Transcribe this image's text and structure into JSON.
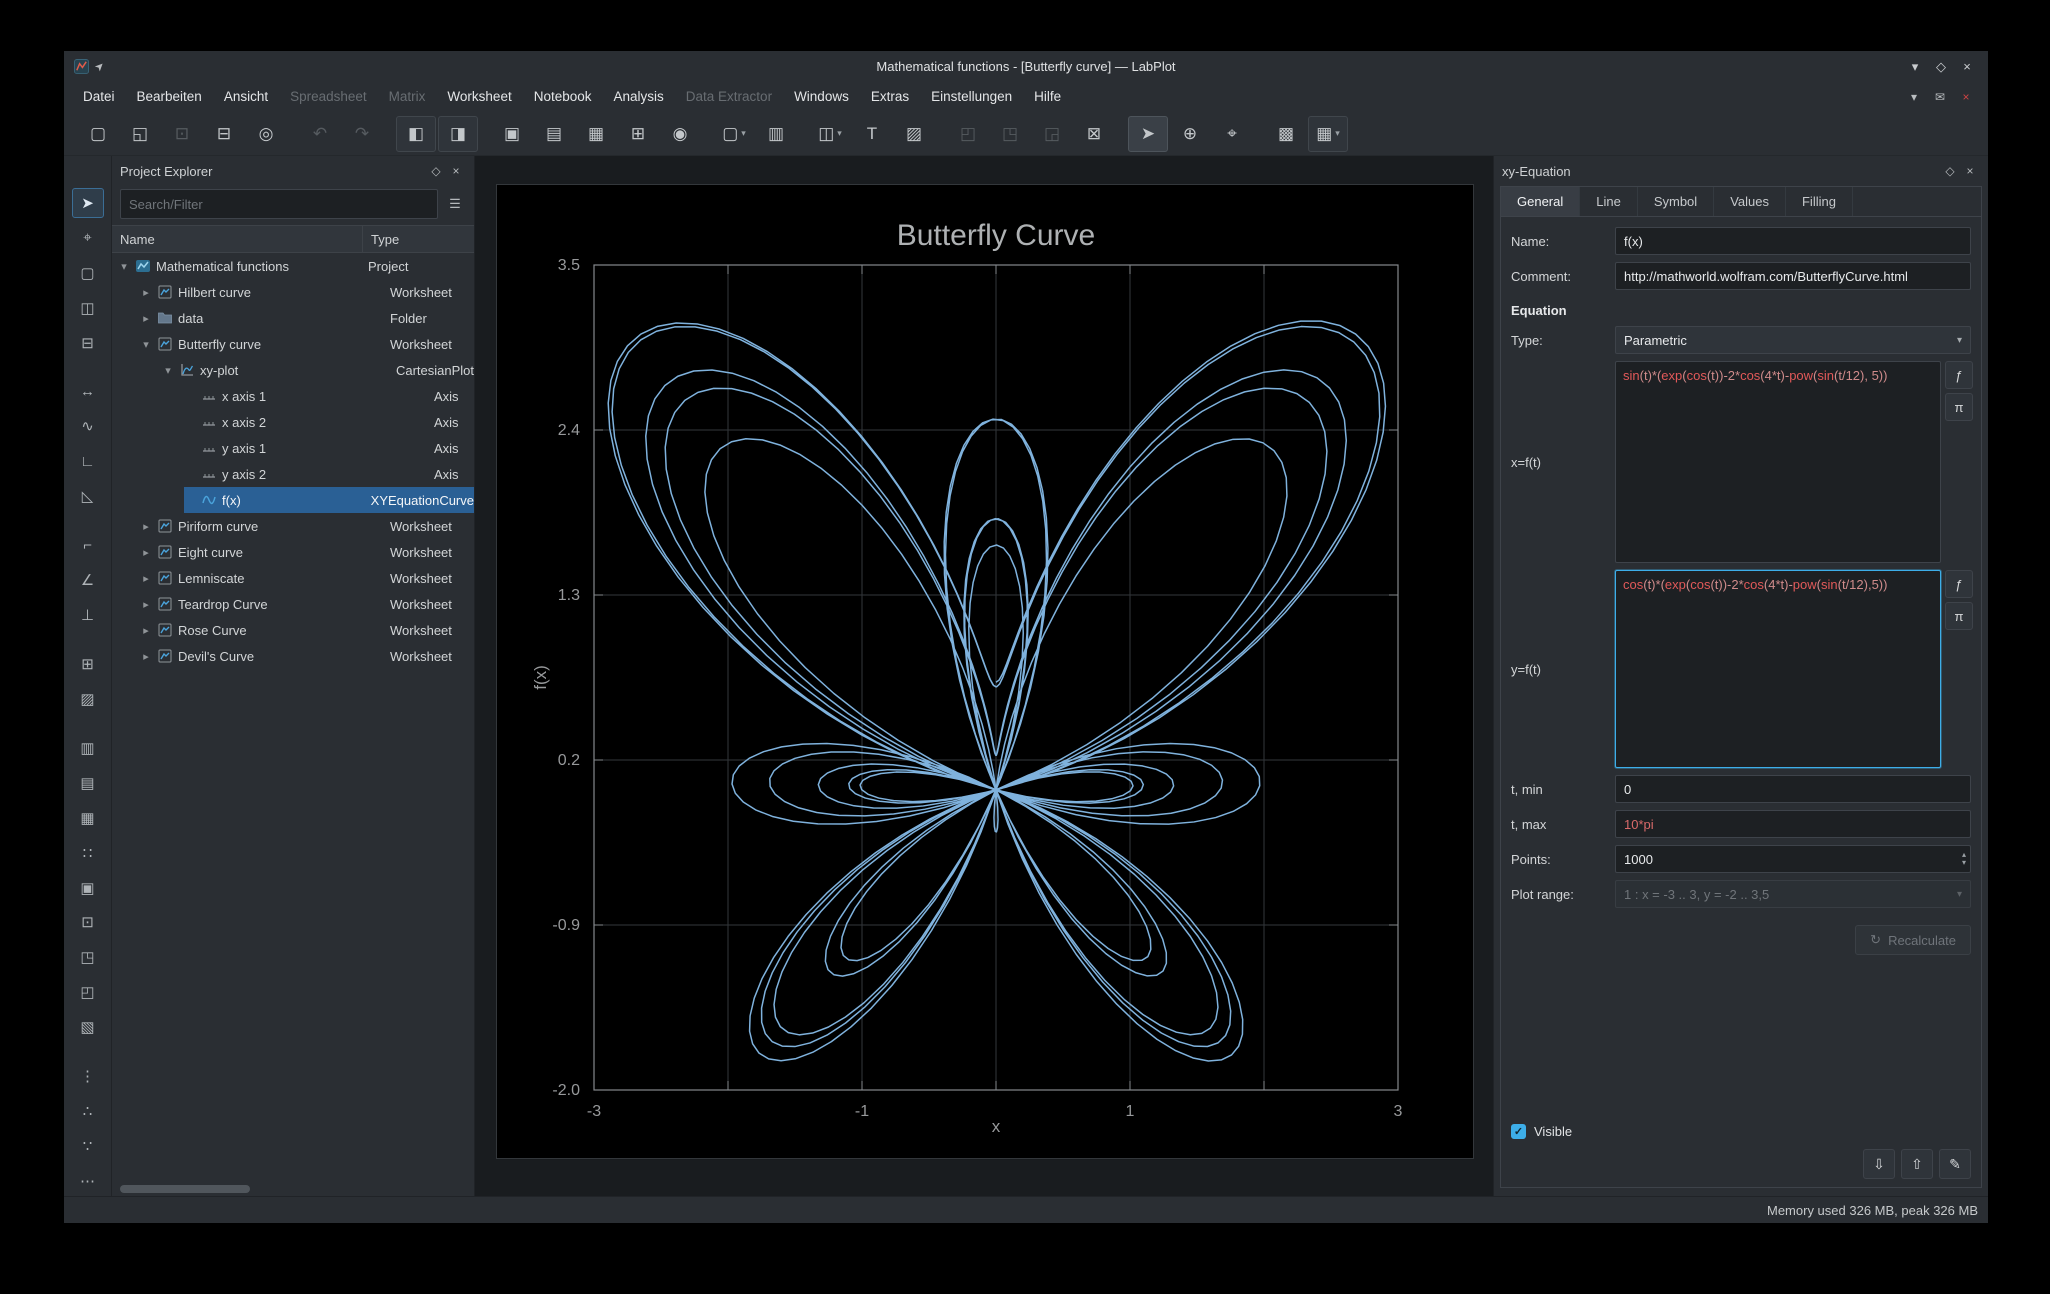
{
  "window": {
    "title": "Mathematical functions - [Butterfly curve] — LabPlot"
  },
  "icons": {
    "minimize": "▾",
    "maximize": "◇",
    "close": "×",
    "float": "◇",
    "chevron_down": "▾",
    "spin_up": "▴",
    "spin_down": "▾",
    "check": "✓",
    "filter": "☰",
    "recalculate": "↻",
    "pin": "➤"
  },
  "menubar": {
    "items": [
      {
        "label": "Datei",
        "enabled": true
      },
      {
        "label": "Bearbeiten",
        "enabled": true
      },
      {
        "label": "Ansicht",
        "enabled": true
      },
      {
        "label": "Spreadsheet",
        "enabled": false
      },
      {
        "label": "Matrix",
        "enabled": false
      },
      {
        "label": "Worksheet",
        "enabled": true
      },
      {
        "label": "Notebook",
        "enabled": true
      },
      {
        "label": "Analysis",
        "enabled": true
      },
      {
        "label": "Data Extractor",
        "enabled": false
      },
      {
        "label": "Windows",
        "enabled": true
      },
      {
        "label": "Extras",
        "enabled": true
      },
      {
        "label": "Einstellungen",
        "enabled": true
      },
      {
        "label": "Hilfe",
        "enabled": true
      }
    ],
    "right_icons": [
      {
        "name": "toolbar-overflow-icon",
        "glyph": "▾",
        "color": "#b9bdc0"
      },
      {
        "name": "donate-icon",
        "glyph": "✉",
        "color": "#b9bdc0"
      },
      {
        "name": "close-document-icon",
        "glyph": "×",
        "color": "#cc4444"
      }
    ]
  },
  "toolbar": {
    "buttons": [
      {
        "name": "new-project",
        "glyph": "▢"
      },
      {
        "name": "open-project",
        "glyph": "◱"
      },
      {
        "name": "save-project",
        "glyph": "⊡",
        "state": "disabled"
      },
      {
        "name": "print",
        "glyph": "⊟"
      },
      {
        "name": "print-preview",
        "glyph": "◎"
      },
      {
        "name": "undo",
        "glyph": "↶",
        "state": "disabled",
        "gap_before": true
      },
      {
        "name": "redo",
        "glyph": "↷",
        "state": "disabled"
      },
      {
        "name": "workbook-view",
        "glyph": "◧",
        "state": "bordered",
        "gap_before": true
      },
      {
        "name": "split-view",
        "glyph": "◨",
        "state": "bordered"
      },
      {
        "name": "new-folder",
        "glyph": "▣",
        "gap_before": true
      },
      {
        "name": "new-spreadsheet",
        "glyph": "▤"
      },
      {
        "name": "new-matrix",
        "glyph": "▦"
      },
      {
        "name": "import-data",
        "glyph": "⊞"
      },
      {
        "name": "color-theme",
        "glyph": "◉"
      },
      {
        "name": "new-worksheet",
        "glyph": "▢",
        "chevron": true,
        "gap_before": true
      },
      {
        "name": "new-notebook",
        "glyph": "▥"
      },
      {
        "name": "zoom-mode",
        "glyph": "◫",
        "chevron": true,
        "gap_before": true
      },
      {
        "name": "add-text-label",
        "glyph": "T"
      },
      {
        "name": "add-image",
        "glyph": "▨"
      },
      {
        "name": "group-objects",
        "glyph": "◰",
        "state": "disabled",
        "gap_before": true
      },
      {
        "name": "align-objects",
        "glyph": "◳",
        "state": "disabled"
      },
      {
        "name": "arrange-objects",
        "glyph": "◲",
        "state": "disabled"
      },
      {
        "name": "break-layout",
        "glyph": "⊠"
      },
      {
        "name": "pointer-mode",
        "glyph": "➤",
        "state": "active",
        "gap_before": true
      },
      {
        "name": "crosshair-mode",
        "glyph": "⊕"
      },
      {
        "name": "zoom-fit",
        "glyph": "⌖"
      },
      {
        "name": "presenter-mode",
        "glyph": "▩",
        "gap_before": true
      },
      {
        "name": "cartesian-plot-add",
        "glyph": "▦",
        "state": "bordered",
        "chevron": true
      }
    ]
  },
  "left_toolbar": {
    "buttons": [
      {
        "name": "select-tool",
        "glyph": "➤",
        "state": "active"
      },
      {
        "name": "crosshair-tool",
        "glyph": "⌖"
      },
      {
        "name": "zoom-select-tool",
        "glyph": "▢"
      },
      {
        "name": "zoom-x-tool",
        "glyph": "◫"
      },
      {
        "name": "zoom-y-tool",
        "glyph": "⊟"
      },
      {
        "name": "shift-curve-tool",
        "glyph": "↔",
        "gap_before": true
      },
      {
        "name": "add-curve-tool",
        "glyph": "∿"
      },
      {
        "name": "add-axis-tool",
        "glyph": "∟"
      },
      {
        "name": "add-legend-tool",
        "glyph": "◺"
      },
      {
        "name": "corner-axis-tool",
        "glyph": "⌐",
        "gap_before": true
      },
      {
        "name": "angle-tool",
        "glyph": "∠"
      },
      {
        "name": "perpendicular-tool",
        "glyph": "⊥"
      },
      {
        "name": "add-grid-tool",
        "glyph": "⊞",
        "gap_before": true
      },
      {
        "name": "add-image-tool",
        "glyph": "▨"
      },
      {
        "name": "layout-v-tool",
        "glyph": "▥",
        "gap_before": true
      },
      {
        "name": "layout-h-tool",
        "glyph": "▤"
      },
      {
        "name": "layout-grid-tool",
        "glyph": "▦"
      },
      {
        "name": "snap-grid-tool",
        "glyph": "∷"
      },
      {
        "name": "box-tool",
        "glyph": "▣"
      },
      {
        "name": "region-tool",
        "glyph": "⊡"
      },
      {
        "name": "panel-tool",
        "glyph": "◳"
      },
      {
        "name": "frame-tool",
        "glyph": "◰"
      },
      {
        "name": "pattern-tool",
        "glyph": "▧"
      },
      {
        "name": "more-tools-1",
        "glyph": "⋮",
        "gap_before": true
      },
      {
        "name": "more-tools-2",
        "glyph": "∴"
      },
      {
        "name": "more-tools-3",
        "glyph": "∵"
      },
      {
        "name": "more-tools-4",
        "glyph": "⋯"
      }
    ]
  },
  "project_explorer": {
    "title": "Project Explorer",
    "search_placeholder": "Search/Filter",
    "columns": [
      "Name",
      "Type"
    ],
    "rows": [
      {
        "name": "Mathematical functions",
        "type": "Project",
        "indent": 0,
        "expander": "open",
        "icon": "project"
      },
      {
        "name": "Hilbert curve",
        "type": "Worksheet",
        "indent": 1,
        "expander": "closed",
        "icon": "worksheet"
      },
      {
        "name": "data",
        "type": "Folder",
        "indent": 1,
        "expander": "closed",
        "icon": "folder"
      },
      {
        "name": "Butterfly curve",
        "type": "Worksheet",
        "indent": 1,
        "expander": "open",
        "icon": "worksheet"
      },
      {
        "name": "xy-plot",
        "type": "CartesianPlot",
        "indent": 2,
        "expander": "open",
        "icon": "plot"
      },
      {
        "name": "x axis 1",
        "type": "Axis",
        "indent": 3,
        "expander": "none",
        "icon": "axis"
      },
      {
        "name": "x axis 2",
        "type": "Axis",
        "indent": 3,
        "expander": "none",
        "icon": "axis"
      },
      {
        "name": "y axis 1",
        "type": "Axis",
        "indent": 3,
        "expander": "none",
        "icon": "axis"
      },
      {
        "name": "y axis 2",
        "type": "Axis",
        "indent": 3,
        "expander": "none",
        "icon": "axis"
      },
      {
        "name": "f(x)",
        "type": "XYEquationCurve",
        "indent": 3,
        "expander": "none",
        "icon": "curve",
        "selected": true
      },
      {
        "name": "Piriform curve",
        "type": "Worksheet",
        "indent": 1,
        "expander": "closed",
        "icon": "worksheet"
      },
      {
        "name": "Eight curve",
        "type": "Worksheet",
        "indent": 1,
        "expander": "closed",
        "icon": "worksheet"
      },
      {
        "name": "Lemniscate",
        "type": "Worksheet",
        "indent": 1,
        "expander": "closed",
        "icon": "worksheet"
      },
      {
        "name": "Teardrop Curve",
        "type": "Worksheet",
        "indent": 1,
        "expander": "closed",
        "icon": "worksheet"
      },
      {
        "name": "Rose Curve",
        "type": "Worksheet",
        "indent": 1,
        "expander": "closed",
        "icon": "worksheet"
      },
      {
        "name": "Devil's Curve",
        "type": "Worksheet",
        "indent": 1,
        "expander": "closed",
        "icon": "worksheet"
      }
    ]
  },
  "chart_data": {
    "type": "line",
    "title": "Butterfly Curve",
    "xlabel": "x",
    "ylabel": "f(x)",
    "xlim": [
      -3,
      3
    ],
    "ylim": [
      -2,
      3.5
    ],
    "x_gridlines": [
      -3,
      -2,
      -1,
      0,
      1,
      2,
      3
    ],
    "x_tick_label_values": [
      -3,
      -1,
      1,
      3
    ],
    "x_tick_labels": [
      "-3",
      "-1",
      "1",
      "3"
    ],
    "y_ticks": [
      3.5,
      2.4,
      1.3,
      0.2,
      -0.9,
      -2.0
    ],
    "y_tick_labels": [
      "3.5",
      "2.4",
      "1.3",
      "0.2",
      "-0.9",
      "-2.0"
    ],
    "grid": true,
    "legend": "off",
    "background": "#000000",
    "grid_color": "#33373b",
    "axis_color": "#85898d",
    "text_color": "#97999b",
    "series": [
      {
        "name": "f(x)",
        "kind": "parametric",
        "x_equation": "sin(t)*(exp(cos(t))-2*cos(4*t)-pow(sin(t/12), 5))",
        "y_equation": "cos(t)*(exp(cos(t))-2*cos(4*t)-pow(sin(t/12),5))",
        "t_min": 0,
        "t_max": "10*pi",
        "points": 1000,
        "color": "#7fb2dd"
      }
    ]
  },
  "equation_dock": {
    "title": "xy-Equation",
    "tabs": [
      "General",
      "Line",
      "Symbol",
      "Values",
      "Filling"
    ],
    "active_tab": 0,
    "name_label": "Name:",
    "name_value": "f(x)",
    "comment_label": "Comment:",
    "comment_value": "http://mathworld.wolfram.com/ButterflyCurve.html",
    "section_equation": "Equation",
    "type_label": "Type:",
    "type_value": "Parametric",
    "x_label": "x=f(t)",
    "x_formula": "sin(t)*(exp(cos(t))-2*cos(4*t)-pow(sin(t/12), 5))",
    "y_label": "y=f(t)",
    "y_formula": "cos(t)*(exp(cos(t))-2*cos(4*t)-pow(sin(t/12),5))",
    "functions_button": "ƒ",
    "constants_button": "π",
    "tmin_label": "t, min",
    "tmin_value": "0",
    "tmax_label": "t, max",
    "tmax_value": "10*pi",
    "points_label": "Points:",
    "points_value": "1000",
    "plot_range_label": "Plot range:",
    "plot_range_value": "1 : x = -3 .. 3, y = -2 .. 3,5",
    "recalculate_label": "Recalculate",
    "visible_label": "Visible",
    "bottom_buttons": [
      {
        "name": "load-template-button",
        "glyph": "⇩"
      },
      {
        "name": "save-template-button",
        "glyph": "⇧"
      },
      {
        "name": "edit-template-button",
        "glyph": "✎"
      }
    ]
  },
  "statusbar": {
    "memory": "Memory used 326 MB, peak 326 MB"
  }
}
